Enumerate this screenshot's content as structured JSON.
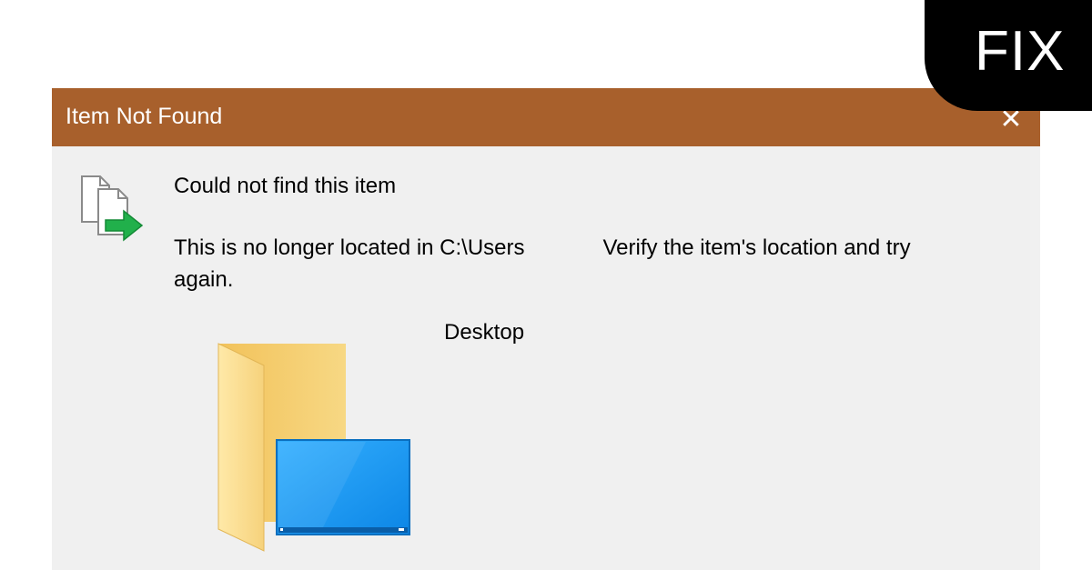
{
  "dialog": {
    "title": "Item Not Found",
    "close_glyph": "✕",
    "heading": "Could not find this item",
    "message_part1": "This is no longer located in C:\\Users",
    "message_part2": "Verify the item's location and try",
    "message_part3": "again.",
    "item_name": "Desktop"
  },
  "badge": {
    "label": "FIX"
  },
  "icons": {
    "status": "file-move-icon",
    "item": "desktop-folder-icon",
    "close": "close-icon"
  },
  "colors": {
    "titlebar": "#a8602c",
    "dialog_bg": "#f0f0f0",
    "badge_bg": "#000000",
    "arrow_green": "#21b04b",
    "folder_yellow": "#f5d27a",
    "screen_blue": "#1e9bf0"
  }
}
